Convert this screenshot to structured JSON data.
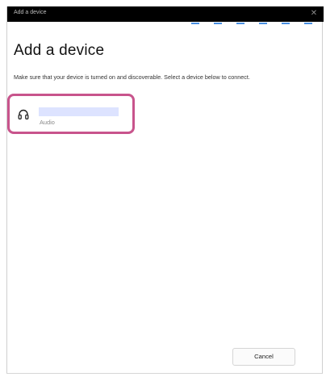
{
  "window": {
    "title": "Add a device",
    "close_glyph": "✕"
  },
  "dialog": {
    "heading": "Add a device",
    "instructions": "Make sure that your device is turned on and discoverable. Select a device below to connect."
  },
  "device": {
    "icon": "headphones-icon",
    "name": "",
    "type": "Audio"
  },
  "buttons": {
    "cancel_label": "Cancel"
  },
  "colors": {
    "highlight": "#c8548c",
    "accent": "#4a90e2",
    "name_redaction": "#dde3ff"
  }
}
